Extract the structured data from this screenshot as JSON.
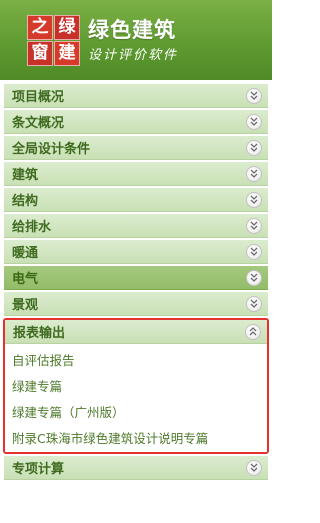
{
  "header": {
    "logo_chars": [
      "之",
      "绿",
      "窗",
      "建"
    ],
    "title": "绿色建筑",
    "subtitle": "设计评价软件"
  },
  "menu": [
    {
      "label": "项目概况",
      "icon": "chevron-down-icon",
      "state": "collapsed"
    },
    {
      "label": "条文概况",
      "icon": "chevron-down-icon",
      "state": "collapsed"
    },
    {
      "label": "全局设计条件",
      "icon": "chevron-down-icon",
      "state": "collapsed"
    },
    {
      "label": "建筑",
      "icon": "chevron-down-icon",
      "state": "collapsed"
    },
    {
      "label": "结构",
      "icon": "chevron-down-icon",
      "state": "collapsed"
    },
    {
      "label": "给排水",
      "icon": "chevron-down-icon",
      "state": "collapsed"
    },
    {
      "label": "暖通",
      "icon": "chevron-down-icon",
      "state": "collapsed"
    },
    {
      "label": "电气",
      "icon": "chevron-down-icon",
      "state": "active"
    },
    {
      "label": "景观",
      "icon": "chevron-down-icon",
      "state": "collapsed"
    }
  ],
  "report_section": {
    "label": "报表输出",
    "icon": "chevron-up-icon",
    "state": "expanded",
    "items": [
      "自评估报告",
      "绿建专篇",
      "绿建专篇（广州版）",
      "附录C珠海市绿色建筑设计说明专篇"
    ]
  },
  "last_item": {
    "label": "专项计算",
    "icon": "chevron-down-icon"
  },
  "colors": {
    "header_green": "#5f9b31",
    "menu_bg": "#c9e0b5",
    "active_bg": "#93bc69",
    "label_green": "#3e6b1f",
    "highlight_red": "#e4312b"
  }
}
